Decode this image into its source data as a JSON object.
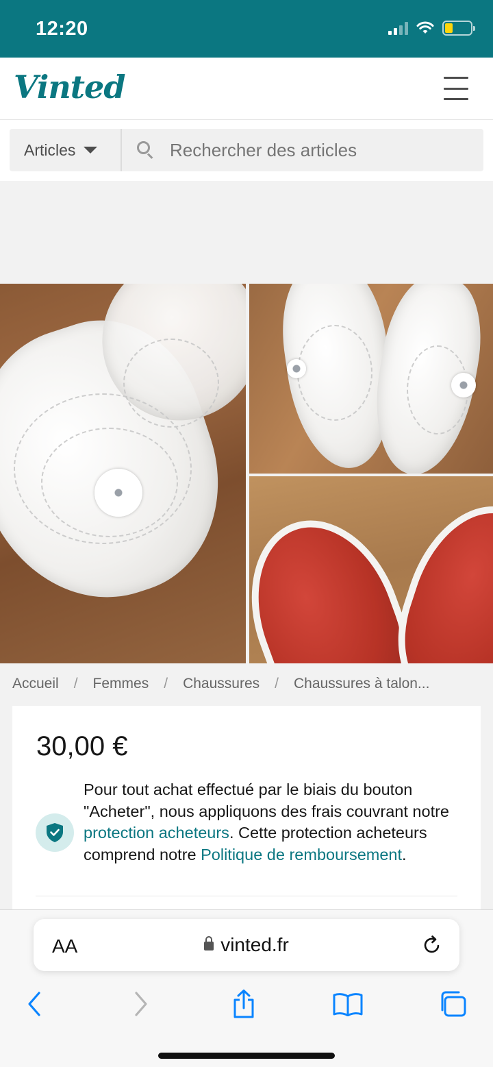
{
  "status_bar": {
    "time": "12:20"
  },
  "header": {
    "logo": "Vinted"
  },
  "search": {
    "category": "Articles",
    "placeholder": "Rechercher des articles"
  },
  "breadcrumb": [
    "Accueil",
    "Femmes",
    "Chaussures",
    "Chaussures à talon..."
  ],
  "product": {
    "price": "30,00 €",
    "protection": {
      "text_1": "Pour tout achat effectué par le biais du bouton \"Acheter\", nous appliquons des frais couvrant notre ",
      "link_1": "protection acheteurs",
      "text_2": ". Cette protection acheteurs comprend notre ",
      "link_2": "Politique de remboursement",
      "text_3": "."
    }
  },
  "safari": {
    "text_size": "AA",
    "url": "vinted.fr"
  },
  "colors": {
    "brand": "#0b7781",
    "link": "#0b7781",
    "battery": "#ffd60a"
  }
}
